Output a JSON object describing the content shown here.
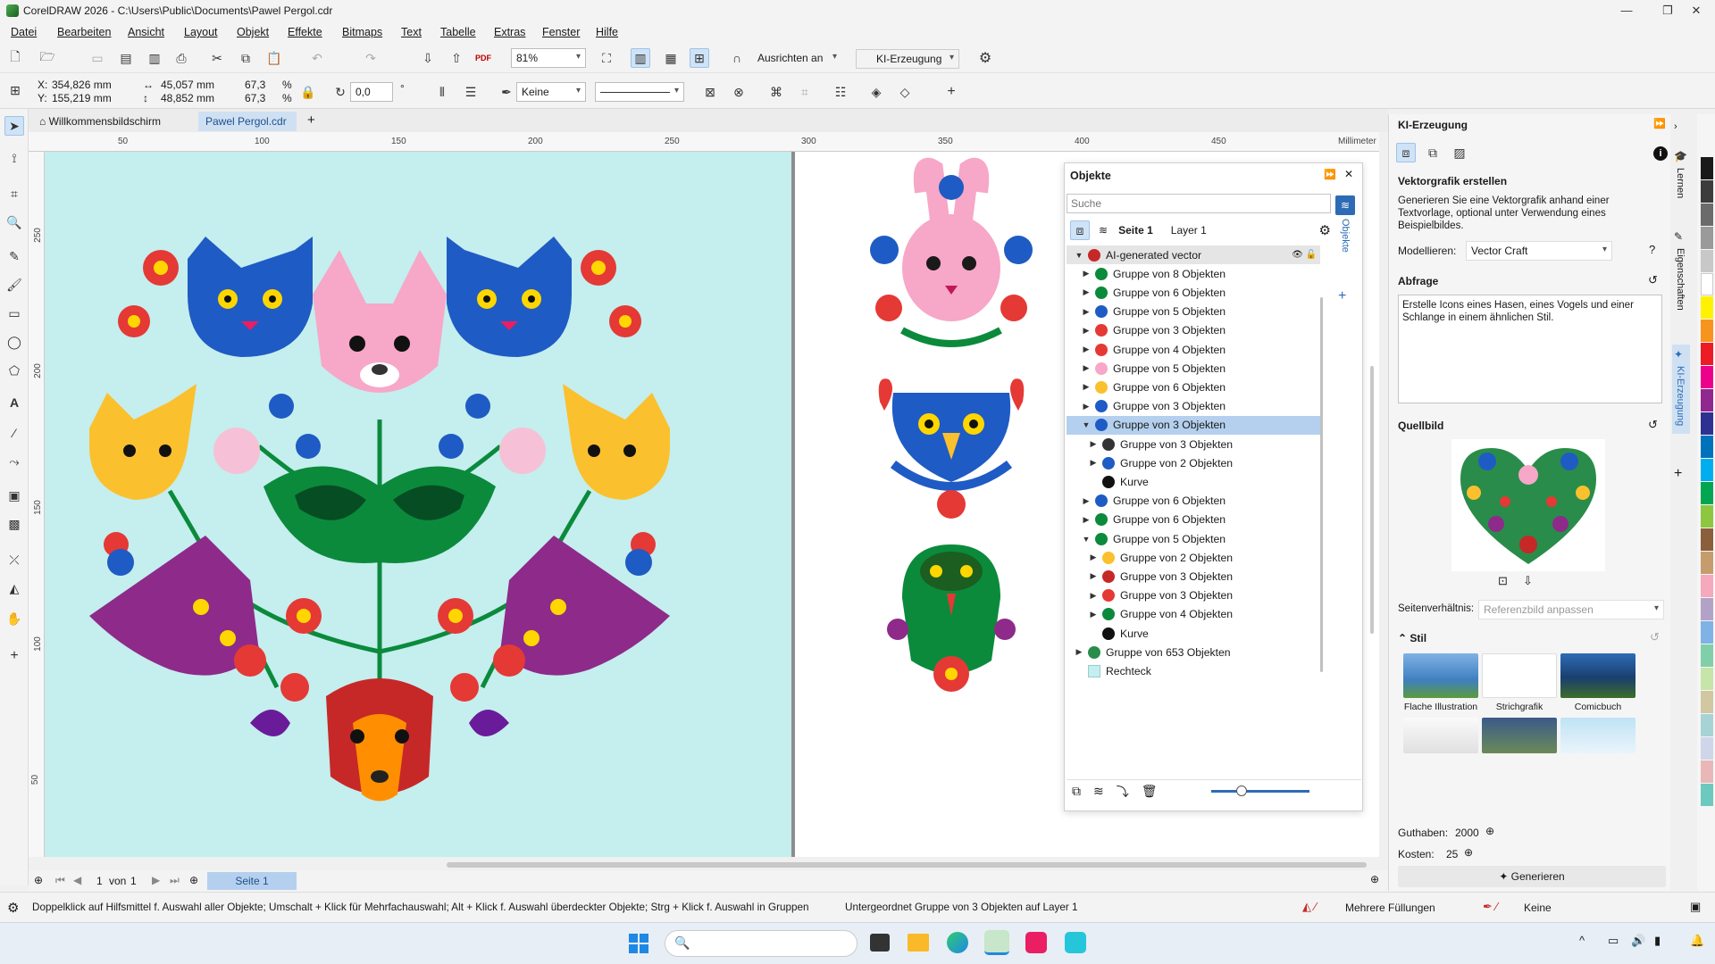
{
  "app": {
    "title": "CorelDRAW 2026 - C:\\Users\\Public\\Documents\\Pawel Pergol.cdr"
  },
  "menu": [
    "Datei",
    "Bearbeiten",
    "Ansicht",
    "Layout",
    "Objekt",
    "Effekte",
    "Bitmaps",
    "Text",
    "Tabelle",
    "Extras",
    "Fenster",
    "Hilfe"
  ],
  "toolbar": {
    "zoom": "81%",
    "snap_label": "Ausrichten an",
    "ai_label": "KI-Erzeugung"
  },
  "props": {
    "x": "354,826 mm",
    "y": "155,219 mm",
    "w": "45,057 mm",
    "h": "48,852 mm",
    "sx": "67,3",
    "sy": "67,3",
    "pct": "%",
    "rot": "0,0",
    "deg": "°",
    "outline": "Keine"
  },
  "tabs": {
    "welcome": "Willkommensbildschirm",
    "doc": "Pawel Pergol.cdr"
  },
  "ruler": {
    "h": [
      "50",
      "100",
      "150",
      "200",
      "250",
      "300",
      "350",
      "400",
      "450"
    ],
    "unit": "Millimeter",
    "v": [
      "250",
      "200",
      "150",
      "100",
      "50"
    ],
    "vunit": "Millimeter"
  },
  "objects": {
    "title": "Objekte",
    "search": "Suche",
    "page": "Seite 1",
    "layer": "Layer 1",
    "tab_label": "Objekte",
    "rows": [
      {
        "label": "AI-generated vector",
        "indent": 0,
        "tri": "▼",
        "icon": "figure"
      },
      {
        "label": "Gruppe von 8 Objekten",
        "indent": 1,
        "tri": "▶",
        "icon": "leaf"
      },
      {
        "label": "Gruppe von 6 Objekten",
        "indent": 1,
        "tri": "▶",
        "icon": "leaf"
      },
      {
        "label": "Gruppe von 5 Objekten",
        "indent": 1,
        "tri": "▶",
        "icon": "flower"
      },
      {
        "label": "Gruppe von 3 Objekten",
        "indent": 1,
        "tri": "▶",
        "icon": "flower-red"
      },
      {
        "label": "Gruppe von 4 Objekten",
        "indent": 1,
        "tri": "▶",
        "icon": "flower-red"
      },
      {
        "label": "Gruppe von 5 Objekten",
        "indent": 1,
        "tri": "▶",
        "icon": "bunny"
      },
      {
        "label": "Gruppe von 6 Objekten",
        "indent": 1,
        "tri": "▶",
        "icon": "dots"
      },
      {
        "label": "Gruppe von 3 Objekten",
        "indent": 1,
        "tri": "▶",
        "icon": "bird"
      },
      {
        "label": "Gruppe von 3 Objekten",
        "indent": 1,
        "tri": "▼",
        "icon": "eagle"
      },
      {
        "label": "Gruppe von 3 Objekten",
        "indent": 2,
        "tri": "▶",
        "icon": "eyes"
      },
      {
        "label": "Gruppe von 2 Objekten",
        "indent": 2,
        "tri": "▶",
        "icon": "eagle"
      },
      {
        "label": "Kurve",
        "indent": 2,
        "tri": "",
        "icon": "dark"
      },
      {
        "label": "Gruppe von 6 Objekten",
        "indent": 1,
        "tri": "▶",
        "icon": "flower"
      },
      {
        "label": "Gruppe von 6 Objekten",
        "indent": 1,
        "tri": "▶",
        "icon": "leaf"
      },
      {
        "label": "Gruppe von 5 Objekten",
        "indent": 1,
        "tri": "▼",
        "icon": "snake"
      },
      {
        "label": "Gruppe von 2 Objekten",
        "indent": 2,
        "tri": "▶",
        "icon": "dots"
      },
      {
        "label": "Gruppe von 3 Objekten",
        "indent": 2,
        "tri": "▶",
        "icon": "pin"
      },
      {
        "label": "Gruppe von 3 Objekten",
        "indent": 2,
        "tri": "▶",
        "icon": "flower-red"
      },
      {
        "label": "Gruppe von 4 Objekten",
        "indent": 2,
        "tri": "▶",
        "icon": "snake"
      },
      {
        "label": "Kurve",
        "indent": 2,
        "tri": "",
        "icon": "dark"
      },
      {
        "label": "Gruppe von 653 Objekten",
        "indent": 0,
        "tri": "▶",
        "icon": "heart"
      },
      {
        "label": "Rechteck",
        "indent": 0,
        "tri": "",
        "icon": "rect"
      }
    ],
    "selected_index": 9
  },
  "pagenav": {
    "current": "1",
    "of": "von",
    "total": "1",
    "page_tab": "Seite 1"
  },
  "status": {
    "hint": "Doppelklick auf Hilfsmittel f. Auswahl aller Objekte; Umschalt + Klick für Mehrfachauswahl; Alt + Klick f. Auswahl überdeckter Objekte; Strg + Klick f. Auswahl in Gruppen",
    "selection": "Untergeordnet Gruppe von 3 Objekten auf Layer 1",
    "fill": "Mehrere Füllungen",
    "outline": "Keine"
  },
  "ki": {
    "header": "KI-Erzeugung",
    "section": "Vektorgrafik erstellen",
    "desc": "Generieren Sie eine Vektorgrafik anhand einer Textvorlage, optional unter Verwendung eines Beispielbildes.",
    "model_label": "Modellieren:",
    "model_value": "Vector Craft",
    "prompt_label": "Abfrage",
    "prompt_text": "Erstelle Icons eines Hasen, eines Vogels und einer Schlange in einem ähnlichen Stil.",
    "source_label": "Quellbild",
    "ratio_label": "Seitenverhältnis:",
    "ratio_value": "Referenzbild anpassen",
    "style_label": "Stil",
    "styles": [
      "Flache Illustration",
      "Strichgrafik",
      "Comicbuch"
    ],
    "credit_label": "Guthaben:",
    "credit_value": "2000",
    "cost_label": "Kosten:",
    "cost_value": "25",
    "generate": "Generieren"
  },
  "sidetabs": [
    "Lernen",
    "Eigenschaften",
    "KI-Erzeugung"
  ],
  "palette": [
    "#1a1a1a",
    "#3c3c3c",
    "#6b6b6b",
    "#9a9a9a",
    "#c8c8c8",
    "#ffffff",
    "#fff200",
    "#f7941d",
    "#ed1c24",
    "#ec008c",
    "#92278f",
    "#2e3192",
    "#0072bc",
    "#00aeef",
    "#00a651",
    "#8dc63f",
    "#8b5e3c",
    "#c69c6d",
    "#f5a9bc",
    "#b3a2c7",
    "#7fb2e5",
    "#80cfa9",
    "#c7e5a8",
    "#d1c7a1",
    "#a7d3d6",
    "#cfd6ea",
    "#e9b7b7",
    "#6dc8bf"
  ],
  "taskbar": {
    "search": ""
  }
}
